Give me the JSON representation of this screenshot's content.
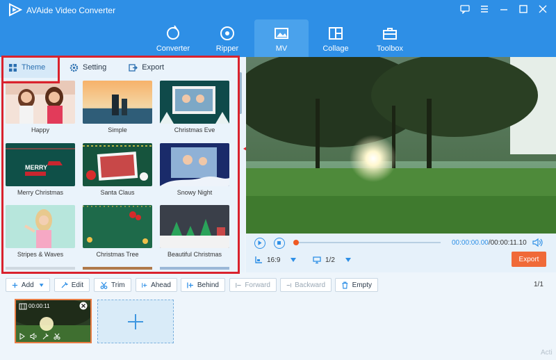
{
  "app": {
    "title": "AVAide Video Converter"
  },
  "nav": [
    {
      "label": "Converter",
      "icon": "refresh-icon"
    },
    {
      "label": "Ripper",
      "icon": "disc-icon"
    },
    {
      "label": "MV",
      "icon": "image-icon",
      "active": true
    },
    {
      "label": "Collage",
      "icon": "collage-icon"
    },
    {
      "label": "Toolbox",
      "icon": "toolbox-icon"
    }
  ],
  "tabs": [
    {
      "label": "Theme",
      "active": true
    },
    {
      "label": "Setting"
    },
    {
      "label": "Export"
    }
  ],
  "themes": [
    {
      "label": "Happy"
    },
    {
      "label": "Simple"
    },
    {
      "label": "Christmas Eve"
    },
    {
      "label": "Merry Christmas"
    },
    {
      "label": "Santa Claus"
    },
    {
      "label": "Snowy Night"
    },
    {
      "label": "Stripes & Waves"
    },
    {
      "label": "Christmas Tree"
    },
    {
      "label": "Beautiful Christmas"
    }
  ],
  "player": {
    "current_time": "00:00:00.00",
    "total_time": "/00:00:11.10",
    "progress": 0.0,
    "aspect": "16:9",
    "page": "1/2",
    "export_label": "Export"
  },
  "toolbar": {
    "add": "Add",
    "edit": "Edit",
    "trim": "Trim",
    "ahead": "Ahead",
    "behind": "Behind",
    "forward": "Forward",
    "backward": "Backward",
    "empty": "Empty",
    "page": "1/1"
  },
  "clip": {
    "duration": "00:00:11"
  },
  "watermark": "Acti",
  "colors": {
    "accent": "#2e8fe6",
    "export": "#f06a38",
    "highlight": "#d9222d"
  }
}
